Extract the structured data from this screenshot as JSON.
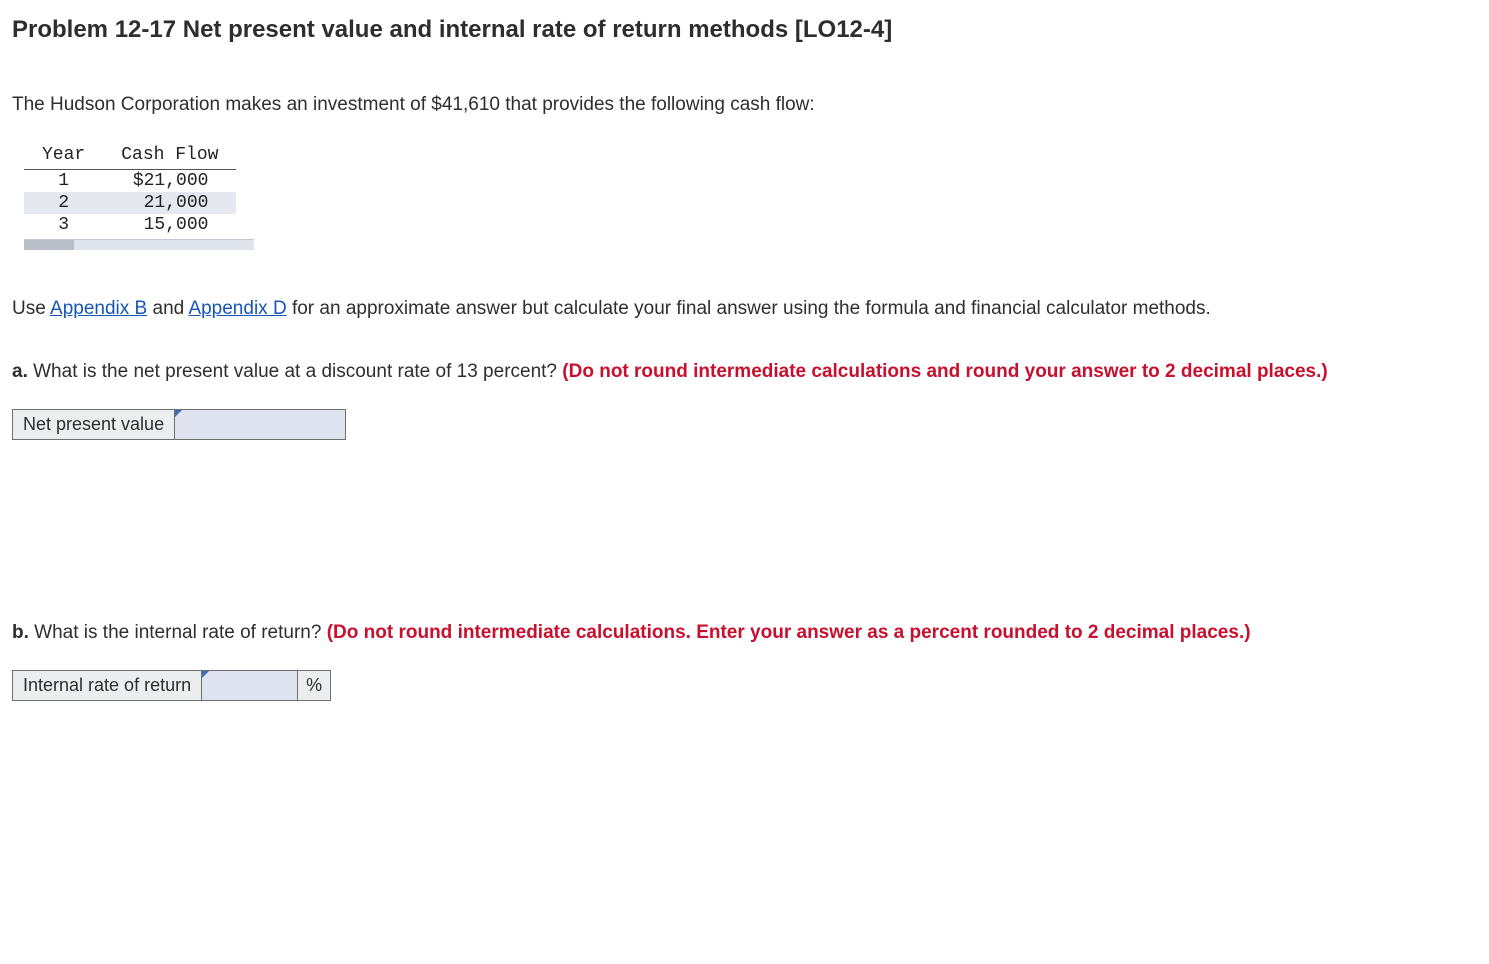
{
  "title": "Problem 12-17 Net present value and internal rate of return methods [LO12-4]",
  "intro": "The Hudson Corporation makes an investment of $41,610 that provides the following cash flow:",
  "cashflow": {
    "headers": {
      "year": "Year",
      "cf": "Cash Flow"
    },
    "rows": [
      {
        "year": "1",
        "cf": "$21,000"
      },
      {
        "year": "2",
        "cf": "21,000"
      },
      {
        "year": "3",
        "cf": "15,000"
      }
    ]
  },
  "useline": {
    "pre": "Use ",
    "link1": "Appendix B",
    "mid": " and ",
    "link2": "Appendix D",
    "post": " for an approximate answer but calculate your final answer using the formula and financial calculator methods."
  },
  "partA": {
    "lead": "a. ",
    "q": "What is the net present value at a discount rate of 13 percent? ",
    "hint": "(Do not round intermediate calculations and round your answer to 2 decimal places.)",
    "label": "Net present value",
    "value": ""
  },
  "partB": {
    "lead": "b. ",
    "q": "What is the internal rate of return? ",
    "hint": "(Do not round intermediate calculations. Enter your answer as a percent rounded to 2 decimal places.)",
    "label": "Internal rate of return",
    "value": "",
    "unit": "%"
  }
}
